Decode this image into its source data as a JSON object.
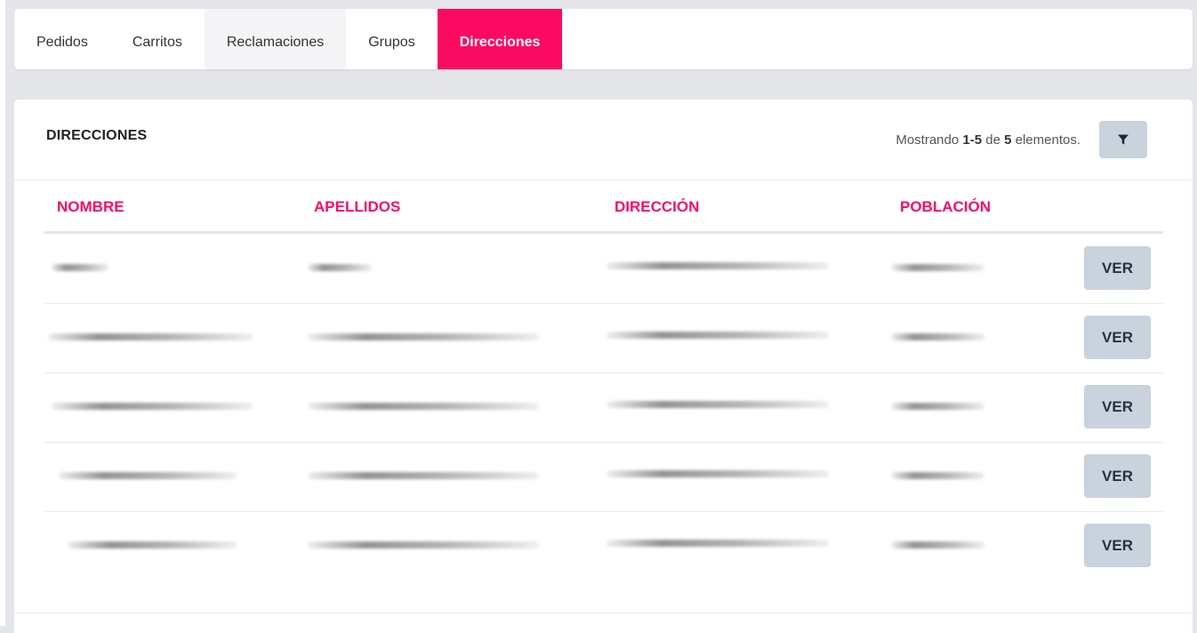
{
  "tabs": [
    {
      "label": "Pedidos",
      "state": "normal"
    },
    {
      "label": "Carritos",
      "state": "normal"
    },
    {
      "label": "Reclamaciones",
      "state": "hovered"
    },
    {
      "label": "Grupos",
      "state": "normal"
    },
    {
      "label": "Direcciones",
      "state": "active"
    }
  ],
  "panel": {
    "title": "DIRECCIONES",
    "summary": {
      "prefix": "Mostrando ",
      "range": "1-5",
      "middle": " de ",
      "total": "5",
      "suffix": " elementos."
    },
    "filter_icon": "filter-icon"
  },
  "table": {
    "columns": [
      "NOMBRE",
      "APELLIDOS",
      "DIRECCIÓN",
      "POBLACIÓN"
    ],
    "rows": [
      {
        "nombre": "",
        "apellidos": "",
        "direccion": "",
        "poblacion": "",
        "action": "VER"
      },
      {
        "nombre": "",
        "apellidos": "",
        "direccion": "",
        "poblacion": "",
        "action": "VER"
      },
      {
        "nombre": "",
        "apellidos": "",
        "direccion": "",
        "poblacion": "",
        "action": "VER"
      },
      {
        "nombre": "",
        "apellidos": "",
        "direccion": "",
        "poblacion": "",
        "action": "VER"
      },
      {
        "nombre": "",
        "apellidos": "",
        "direccion": "",
        "poblacion": "",
        "action": "VER"
      }
    ]
  },
  "colors": {
    "accent": "#fb0a62",
    "button_bg": "#c8d3de",
    "page_bg": "#e4e6ea"
  }
}
